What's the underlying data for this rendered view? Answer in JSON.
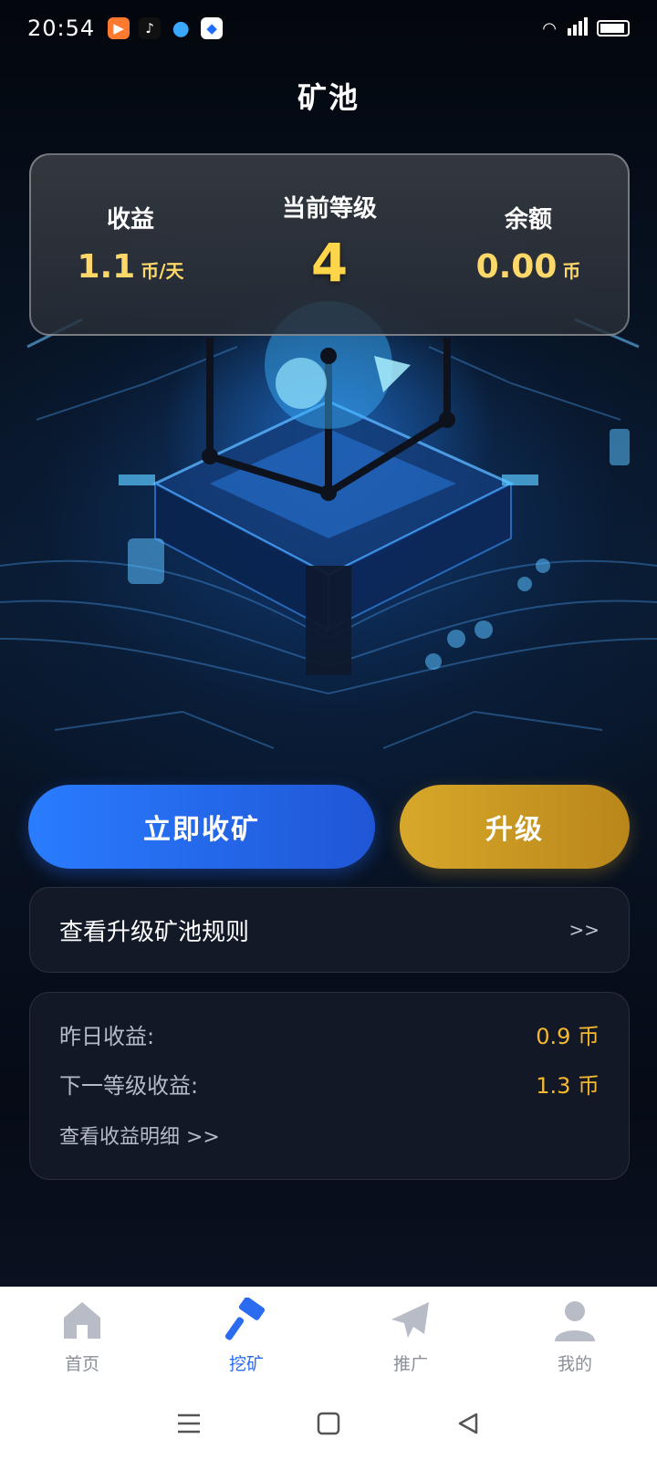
{
  "status_bar": {
    "time": "20:54",
    "apps": [
      "bilibili",
      "tiktok",
      "qq",
      "browser"
    ],
    "battery": "87"
  },
  "header": {
    "title": "矿池"
  },
  "stats": {
    "income_label": "收益",
    "income_value": "1.1",
    "income_unit": "币/天",
    "level_label": "当前等级",
    "level_value": "4",
    "balance_label": "余额",
    "balance_value": "0.00",
    "balance_unit": "币"
  },
  "actions": {
    "collect_label": "立即收矿",
    "upgrade_label": "升级"
  },
  "rules": {
    "text": "查看升级矿池规则",
    "arrow": ">>"
  },
  "income": {
    "yesterday_label": "昨日收益:",
    "yesterday_value": "0.9 币",
    "next_label": "下一等级收益:",
    "next_value": "1.3 币",
    "detail_link": "查看收益明细 >>"
  },
  "nav": {
    "items": [
      {
        "label": "首页",
        "icon": "home-icon"
      },
      {
        "label": "挖矿",
        "icon": "hammer-icon"
      },
      {
        "label": "推广",
        "icon": "paper-plane-icon"
      },
      {
        "label": "我的",
        "icon": "user-icon"
      }
    ],
    "active_index": 1
  },
  "colors": {
    "accent_blue": "#2a7cff",
    "accent_gold": "#d7a82a",
    "value_gold": "#f5b82e"
  }
}
